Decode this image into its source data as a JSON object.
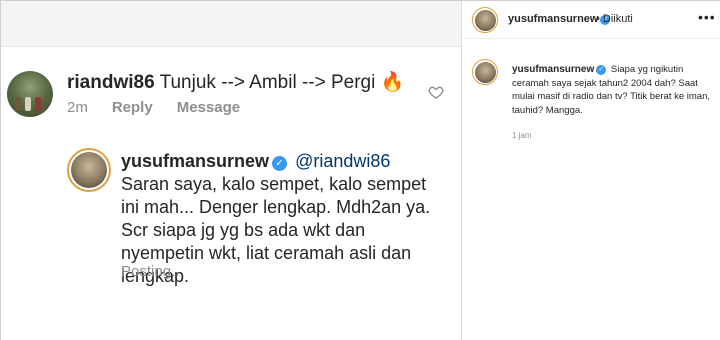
{
  "comment": {
    "username": "riandwi86",
    "text": "Tunjuk --> Ambil --> Pergi 🔥",
    "time": "2m",
    "reply_label": "Reply",
    "message_label": "Message"
  },
  "reply": {
    "username": "yusufmansurnew",
    "mention": "@riandwi86",
    "text": "Saran saya, kalo sempet, kalo sempet ini mah... Denger lengkap. Mdh2an ya. Scr siapa jg yg bs ada wkt dan nyempetin wkt, liat ceramah asli dan lengkap.",
    "status": "Posting..."
  },
  "post_header": {
    "username": "yusufmansurnew",
    "follow_status": "• Diikuti",
    "more_icon": "•••"
  },
  "caption": {
    "username": "yusufmansurnew",
    "text": "Siapa yg ngikutin ceramah saya sejak tahun2 2004 dah? Saat mulai masif di radio dan tv? Titik berat ke iman, tauhid? Mangga.",
    "time": "1 jam"
  },
  "icons": {
    "verified": "verified-badge-icon",
    "heart": "heart-outline-icon",
    "more": "more-dots-icon"
  },
  "colors": {
    "verified_blue": "#3897f0",
    "mention": "#00376b",
    "muted": "#8e8e8e",
    "story_ring": "#e0a040"
  }
}
